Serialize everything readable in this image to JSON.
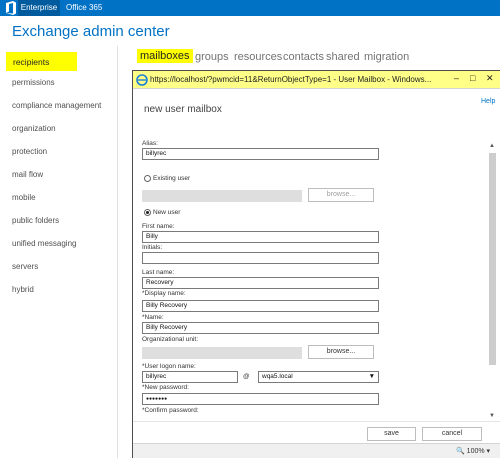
{
  "topbar": {
    "enterprise": "Enterprise",
    "office365": "Office 365"
  },
  "app": {
    "title": "Exchange admin center"
  },
  "sidebar": {
    "items": [
      {
        "label": "recipients"
      },
      {
        "label": "permissions"
      },
      {
        "label": "compliance management"
      },
      {
        "label": "organization"
      },
      {
        "label": "protection"
      },
      {
        "label": "mail flow"
      },
      {
        "label": "mobile"
      },
      {
        "label": "public folders"
      },
      {
        "label": "unified messaging"
      },
      {
        "label": "servers"
      },
      {
        "label": "hybrid"
      }
    ]
  },
  "tabs": [
    {
      "label": "mailboxes"
    },
    {
      "label": "groups"
    },
    {
      "label": "resources"
    },
    {
      "label": "contacts"
    },
    {
      "label": "shared"
    },
    {
      "label": "migration"
    }
  ],
  "dialog": {
    "title": "https://localhost/?pwmcid=11&ReturnObjectType=1 - User Mailbox - Windows...",
    "heading": "new user mailbox",
    "help": "Help",
    "alias_label": "Alias:",
    "alias_value": "billyrec",
    "existing_user_label": "Existing user",
    "browse_label": "browse...",
    "new_user_label": "New user",
    "first_name_label": "First name:",
    "first_name_value": "Billy",
    "initials_label": "Initials:",
    "initials_value": "",
    "last_name_label": "Last name:",
    "last_name_value": "Recovery",
    "display_name_label": "*Display name:",
    "display_name_value": "Billy Recovery",
    "name_label": "*Name:",
    "name_value": "Billy Recovery",
    "ou_label": "Organizational unit:",
    "ou_browse_label": "browse...",
    "logon_label": "*User logon name:",
    "logon_value": "billyrec",
    "at_sign": "@",
    "domain_value": "wqa5.local",
    "password_label": "*New password:",
    "password_value": "●●●●●●●",
    "confirm_label": "*Confirm password:",
    "save_label": "save",
    "cancel_label": "cancel",
    "zoom": "100%"
  },
  "colors": {
    "accent": "#0072c6",
    "highlight": "#ffff00",
    "titlebar": "#ffff88"
  }
}
